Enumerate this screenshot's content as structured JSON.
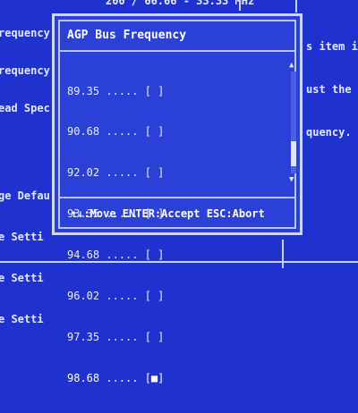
{
  "background": {
    "top_fragment": "200 / 66.66 - 33.33 MHz",
    "left_lines": [
      "requency",
      "requency",
      "ead Spec",
      "",
      "ge Defau",
      "e Setti",
      "e Setti",
      "e Setti"
    ],
    "right_lines": [
      "s item i",
      "ust the",
      "quency."
    ]
  },
  "dialog": {
    "title": "AGP Bus Frequency",
    "items": [
      {
        "text": "89.35 ..... [ ]",
        "selected": false
      },
      {
        "text": "90.68 ..... [ ]",
        "selected": false
      },
      {
        "text": "92.02 ..... [ ]",
        "selected": false
      },
      {
        "text": "93.35 ..... [ ]",
        "selected": false
      },
      {
        "text": "94.68 ..... [ ]",
        "selected": false
      },
      {
        "text": "96.02 ..... [ ]",
        "selected": false
      },
      {
        "text": "97.35 ..... [ ]",
        "selected": false
      },
      {
        "text": "98.68 ..... [■]",
        "selected": true
      }
    ],
    "scroll_up_icon": "▲",
    "scroll_down_icon": "▼",
    "footer": "↑↓:Move ENTER:Accept ESC:Abort"
  },
  "colors": {
    "background": "#1f32cf",
    "dialog": "#2a40d6",
    "border": "#cfd7ff"
  }
}
